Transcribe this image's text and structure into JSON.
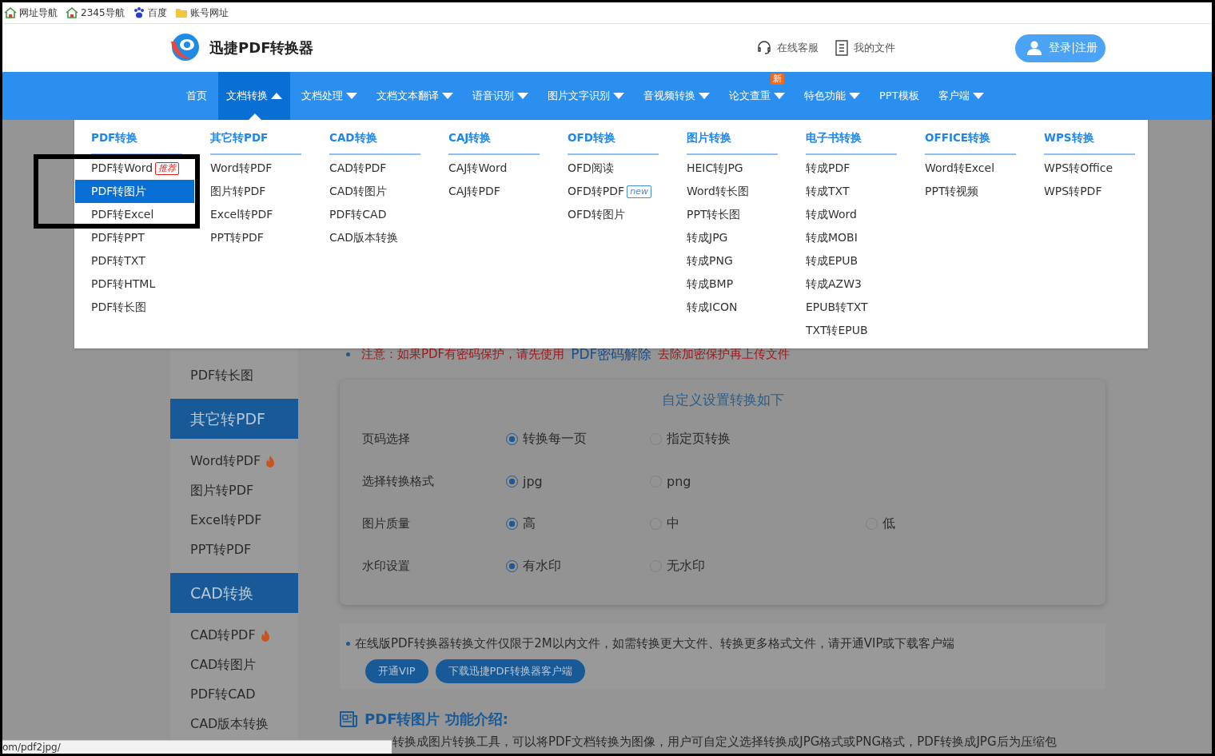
{
  "bookmarks": [
    {
      "kind": "house",
      "label": "网址导航"
    },
    {
      "kind": "house",
      "label": "2345导航"
    },
    {
      "kind": "paw",
      "label": "百度"
    },
    {
      "kind": "folder",
      "label": "账号网址"
    }
  ],
  "header": {
    "title": "迅捷PDF转换器",
    "links": [
      {
        "kind": "headset",
        "label": "在线客服"
      },
      {
        "kind": "document",
        "label": "我的文件"
      }
    ],
    "login": "登录|注册"
  },
  "nav": [
    {
      "label": "首页",
      "selected": false,
      "has_menu": false
    },
    {
      "label": "文档转换",
      "selected": true,
      "has_menu": true
    },
    {
      "label": "文档处理",
      "selected": false,
      "has_menu": true
    },
    {
      "label": "文档文本翻译",
      "selected": false,
      "has_menu": true
    },
    {
      "label": "语音识别",
      "selected": false,
      "has_menu": true
    },
    {
      "label": "图片文字识别",
      "selected": false,
      "has_menu": true
    },
    {
      "label": "音视频转换",
      "selected": false,
      "has_menu": true
    },
    {
      "label": "论文查重",
      "selected": false,
      "has_menu": true,
      "badge": "新"
    },
    {
      "label": "特色功能",
      "selected": false,
      "has_menu": true
    },
    {
      "label": "PPT模板",
      "selected": false,
      "has_menu": false
    },
    {
      "label": "客户端",
      "selected": false,
      "has_menu": true
    }
  ],
  "dropdown": [
    {
      "title": "PDF转换",
      "items": [
        {
          "label": "PDF转Word",
          "selected": false,
          "badge": {
            "kind": "hot",
            "text": "推荐"
          }
        },
        {
          "label": "PDF转图片",
          "selected": true
        },
        {
          "label": "PDF转Excel",
          "selected": false
        },
        {
          "label": "PDF转PPT",
          "selected": false
        },
        {
          "label": "PDF转TXT",
          "selected": false
        },
        {
          "label": "PDF转HTML",
          "selected": false
        },
        {
          "label": "PDF转长图",
          "selected": false
        }
      ]
    },
    {
      "title": "其它转PDF",
      "items": [
        {
          "label": "Word转PDF",
          "selected": false
        },
        {
          "label": "图片转PDF",
          "selected": false
        },
        {
          "label": "Excel转PDF",
          "selected": false
        },
        {
          "label": "PPT转PDF",
          "selected": false
        }
      ]
    },
    {
      "title": "CAD转换",
      "items": [
        {
          "label": "CAD转PDF",
          "selected": false
        },
        {
          "label": "CAD转图片",
          "selected": false
        },
        {
          "label": "PDF转CAD",
          "selected": false
        },
        {
          "label": "CAD版本转换",
          "selected": false
        }
      ]
    },
    {
      "title": "CAJ转换",
      "items": [
        {
          "label": "CAJ转Word",
          "selected": false
        },
        {
          "label": "CAJ转PDF",
          "selected": false
        }
      ]
    },
    {
      "title": "OFD转换",
      "items": [
        {
          "label": "OFD阅读",
          "selected": false
        },
        {
          "label": "OFD转PDF",
          "selected": false,
          "badge": {
            "kind": "new",
            "text": "new"
          }
        },
        {
          "label": "OFD转图片",
          "selected": false
        }
      ]
    },
    {
      "title": "图片转换",
      "items": [
        {
          "label": "HEIC转JPG",
          "selected": false
        },
        {
          "label": "Word转长图",
          "selected": false
        },
        {
          "label": "PPT转长图",
          "selected": false
        },
        {
          "label": "转成JPG",
          "selected": false
        },
        {
          "label": "转成PNG",
          "selected": false
        },
        {
          "label": "转成BMP",
          "selected": false
        },
        {
          "label": "转成ICON",
          "selected": false
        }
      ]
    },
    {
      "title": "电子书转换",
      "items": [
        {
          "label": "转成PDF",
          "selected": false
        },
        {
          "label": "转成TXT",
          "selected": false
        },
        {
          "label": "转成Word",
          "selected": false
        },
        {
          "label": "转成MOBI",
          "selected": false
        },
        {
          "label": "转成EPUB",
          "selected": false
        },
        {
          "label": "转成AZW3",
          "selected": false
        },
        {
          "label": "EPUB转TXT",
          "selected": false
        },
        {
          "label": "TXT转EPUB",
          "selected": false
        }
      ]
    },
    {
      "title": "OFFICE转换",
      "items": [
        {
          "label": "Word转Excel",
          "selected": false
        },
        {
          "label": "PPT转视频",
          "selected": false
        }
      ]
    },
    {
      "title": "WPS转换",
      "items": [
        {
          "label": "WPS转Office",
          "selected": false
        },
        {
          "label": "WPS转PDF",
          "selected": false
        }
      ]
    }
  ],
  "sidebar": [
    {
      "kind": "item",
      "label": "PDF转长图",
      "hot": false
    },
    {
      "kind": "section",
      "label": "其它转PDF"
    },
    {
      "kind": "item",
      "label": "Word转PDF",
      "hot": true
    },
    {
      "kind": "item",
      "label": "图片转PDF",
      "hot": false
    },
    {
      "kind": "item",
      "label": "Excel转PDF",
      "hot": false
    },
    {
      "kind": "item",
      "label": "PPT转PDF",
      "hot": false
    },
    {
      "kind": "section",
      "label": "CAD转换"
    },
    {
      "kind": "item",
      "label": "CAD转PDF",
      "hot": true
    },
    {
      "kind": "item",
      "label": "CAD转图片",
      "hot": false
    },
    {
      "kind": "item",
      "label": "PDF转CAD",
      "hot": false
    },
    {
      "kind": "item",
      "label": "CAD版本转换",
      "hot": false
    }
  ],
  "notice": {
    "before": "注意：如果PDF有密码保护，请先使用",
    "link": "PDF密码解除",
    "after": "去除加密保护再上传文件"
  },
  "settings": {
    "title": "自定义设置转换如下",
    "rows": [
      {
        "label": "页码选择",
        "options": [
          {
            "label": "转换每一页",
            "selected": true
          },
          {
            "label": "指定页转换",
            "selected": false
          }
        ]
      },
      {
        "label": "选择转换格式",
        "options": [
          {
            "label": "jpg",
            "selected": true
          },
          {
            "label": "png",
            "selected": false
          }
        ]
      },
      {
        "label": "图片质量",
        "options": [
          {
            "label": "高",
            "selected": true
          },
          {
            "label": "中",
            "selected": false
          },
          {
            "label": "低",
            "selected": false
          }
        ]
      },
      {
        "label": "水印设置",
        "options": [
          {
            "label": "有水印",
            "selected": true
          },
          {
            "label": "无水印",
            "selected": false
          }
        ]
      }
    ]
  },
  "info": {
    "text": "在线版PDF转换器转换文件仅限于2M以内文件，如需转换更大文件、转换更多格式文件，请开通VIP或下载客户端",
    "buttons": [
      "开通VIP",
      "下载迅捷PDF转换器客户端"
    ]
  },
  "feature": {
    "heading": "PDF转图片 功能介绍:",
    "text": "转换成图片转换工具，可以将PDF文档转换为图像，用户可自定义选择转换成JPG格式或PNG格式，PDF转换成JPG后为压缩包"
  },
  "status_url": "om/pdf2jpg/"
}
